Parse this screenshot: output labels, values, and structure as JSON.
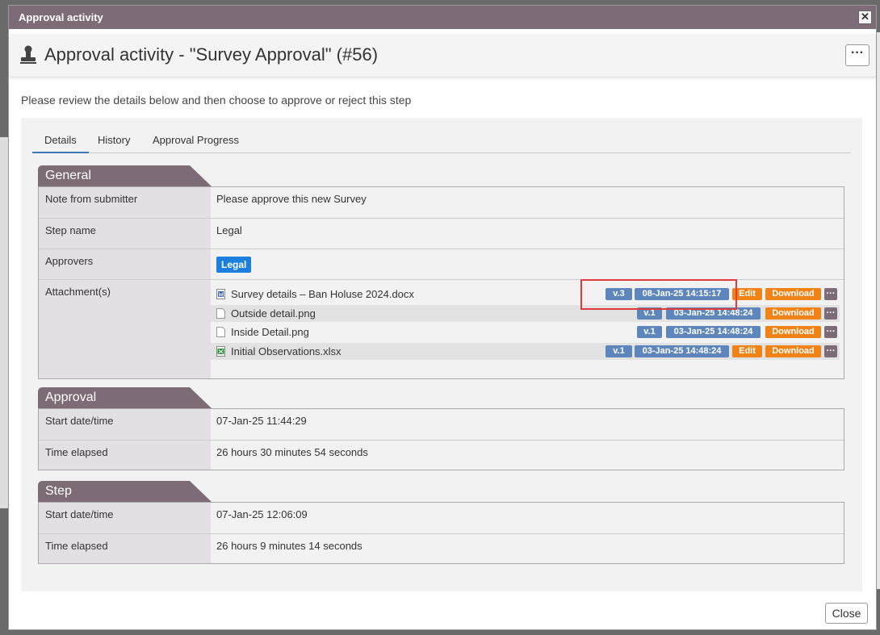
{
  "dialog": {
    "title": "Approval activity",
    "close_glyph": "✕"
  },
  "header": {
    "title": "Approval activity - \"Survey Approval\" (#56)",
    "more_glyph": "···"
  },
  "instructions": "Please review the details below and then choose to approve or reject this step",
  "tabs": [
    {
      "label": "Details",
      "active": true
    },
    {
      "label": "History",
      "active": false
    },
    {
      "label": "Approval Progress",
      "active": false
    }
  ],
  "general": {
    "heading": "General",
    "note_label": "Note from submitter",
    "note_value": "Please approve this new Survey",
    "step_label": "Step name",
    "step_value": "Legal",
    "approvers_label": "Approvers",
    "approvers_value": "Legal",
    "attachments_label": "Attachment(s)",
    "attachments": [
      {
        "name": "Survey details – Ban Holuse 2024.docx",
        "icon": "word-file-icon",
        "version": "v.3",
        "date": "08-Jan-25 14:15:17",
        "edit": "Edit",
        "download": "Download",
        "more": "···"
      },
      {
        "name": "Outside detail.png",
        "icon": "image-file-icon",
        "version": "v.1",
        "date": "03-Jan-25 14:48:24",
        "edit": "",
        "download": "Download",
        "more": "···"
      },
      {
        "name": "Inside Detail.png",
        "icon": "image-file-icon",
        "version": "v.1",
        "date": "03-Jan-25 14:48:24",
        "edit": "",
        "download": "Download",
        "more": "···"
      },
      {
        "name": "Initial Observations.xlsx",
        "icon": "excel-file-icon",
        "version": "v.1",
        "date": "03-Jan-25 14:48:24",
        "edit": "Edit",
        "download": "Download",
        "more": "···"
      }
    ]
  },
  "approval": {
    "heading": "Approval",
    "start_label": "Start date/time",
    "start_value": "07-Jan-25 11:44:29",
    "elapsed_label": "Time elapsed",
    "elapsed_value": "26 hours 30 minutes 54 seconds"
  },
  "step": {
    "heading": "Step",
    "start_label": "Start date/time",
    "start_value": "07-Jan-25 12:06:09",
    "elapsed_label": "Time elapsed",
    "elapsed_value": "26 hours 9 minutes 14 seconds"
  },
  "footer": {
    "close_label": "Close"
  },
  "colors": {
    "titlebar": "#7d6b78",
    "version_pill": "#5d86bd",
    "action_pill": "#f08216",
    "legal_badge": "#1b7fde",
    "highlight": "#e03a3a"
  }
}
